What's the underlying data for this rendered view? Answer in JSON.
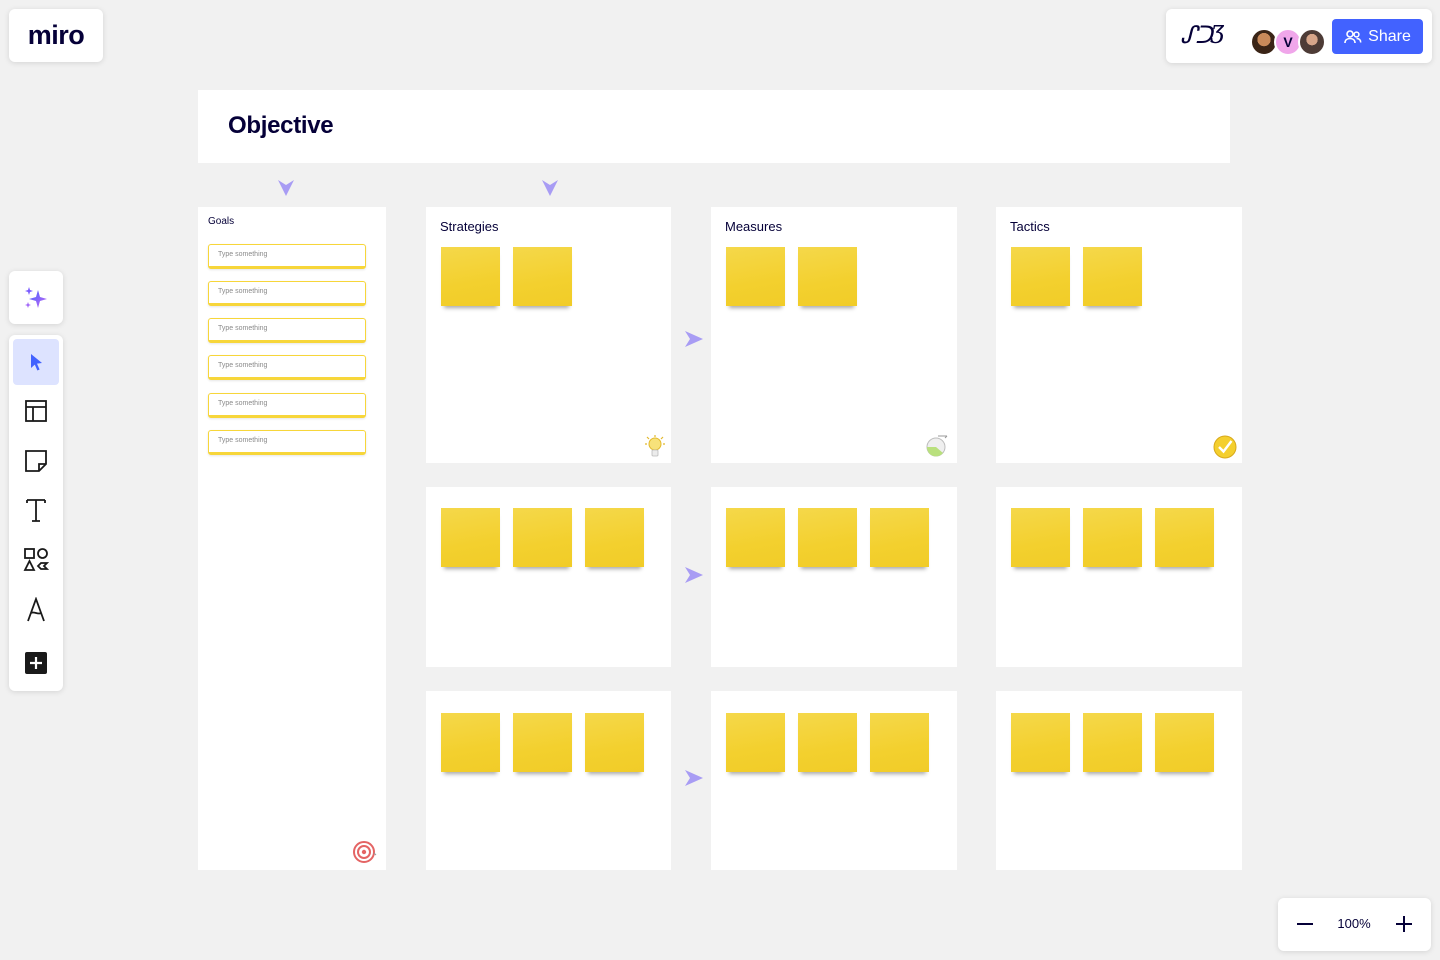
{
  "app": {
    "logo_text": "miro"
  },
  "header": {
    "board_glyph": "ᔑᑐƷ",
    "avatars": [
      {
        "name": "avatar-1",
        "initial": ""
      },
      {
        "name": "avatar-2",
        "initial": "V"
      },
      {
        "name": "avatar-3",
        "initial": ""
      }
    ],
    "share_label": "Share"
  },
  "toolbar": {
    "tools": [
      {
        "name": "select",
        "icon": "cursor-icon",
        "active": true
      },
      {
        "name": "templates",
        "icon": "layout-icon"
      },
      {
        "name": "sticky-note",
        "icon": "sticky-note-icon"
      },
      {
        "name": "text",
        "icon": "text-icon"
      },
      {
        "name": "shapes",
        "icon": "shapes-icon"
      },
      {
        "name": "pen",
        "icon": "pen-icon"
      },
      {
        "name": "more",
        "icon": "plus-square-icon"
      }
    ],
    "ai_icon": "sparkle-icon"
  },
  "board": {
    "objective_title": "Objective",
    "goals": {
      "title": "Goals",
      "fields": [
        "Type something",
        "Type something",
        "Type something",
        "Type something",
        "Type something",
        "Type something"
      ],
      "corner_icon": "target-icon"
    },
    "columns": [
      {
        "title": "Strategies",
        "corner_icon": "lightbulb-icon"
      },
      {
        "title": "Measures",
        "corner_icon": "chart-icon"
      },
      {
        "title": "Tactics",
        "corner_icon": "checkmark-icon"
      }
    ],
    "colors": {
      "sticky": "#f3d02e",
      "arrow": "#a89cf4",
      "accent": "#4262ff"
    }
  },
  "zoom": {
    "level": "100%"
  }
}
